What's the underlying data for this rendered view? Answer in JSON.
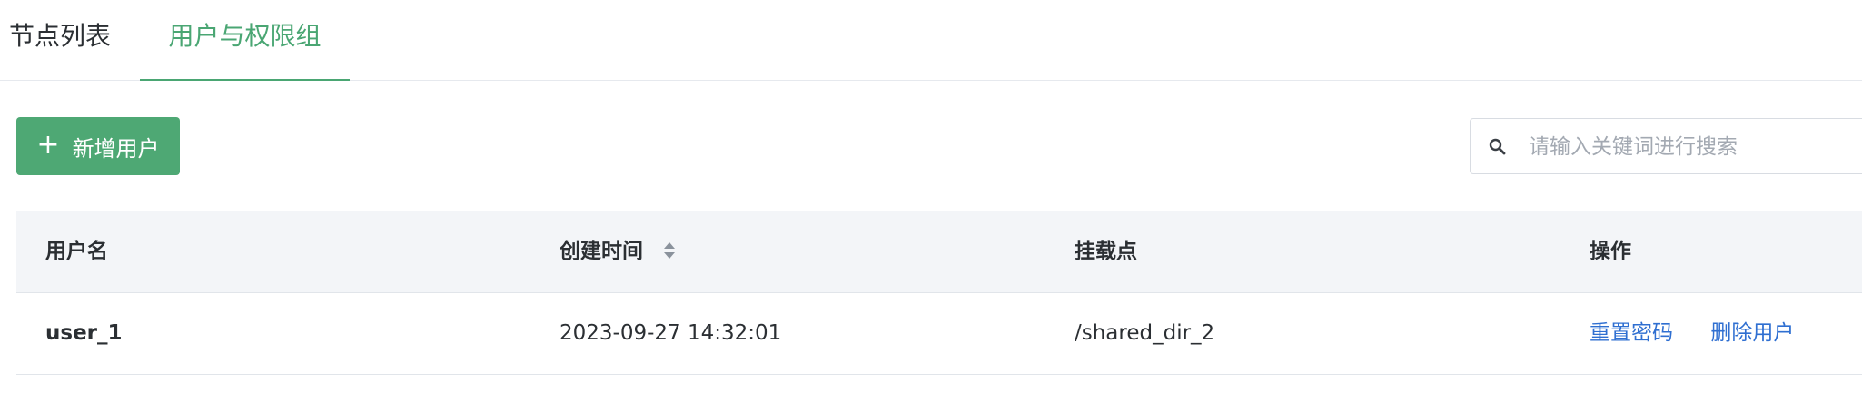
{
  "tabs": [
    {
      "label": "节点列表",
      "active": false
    },
    {
      "label": "用户与权限组",
      "active": true
    }
  ],
  "toolbar": {
    "add_user_label": "新增用户",
    "add_icon": "plus-icon"
  },
  "search": {
    "placeholder": "请输入关键词进行搜索",
    "value": "",
    "icon": "search-icon"
  },
  "table": {
    "columns": [
      {
        "label": "用户名"
      },
      {
        "label": "创建时间",
        "sortable": true
      },
      {
        "label": "挂载点"
      },
      {
        "label": "操作"
      }
    ],
    "rows": [
      {
        "username": "user_1",
        "created": "2023-09-27 14:32:01",
        "mount": "/shared_dir_2",
        "actions": [
          "重置密码",
          "删除用户"
        ]
      }
    ]
  },
  "colors": {
    "accent": "#4aa673",
    "button_bg": "#4ea874",
    "link": "#2f6fd1",
    "header_bg": "#f3f5f8"
  }
}
